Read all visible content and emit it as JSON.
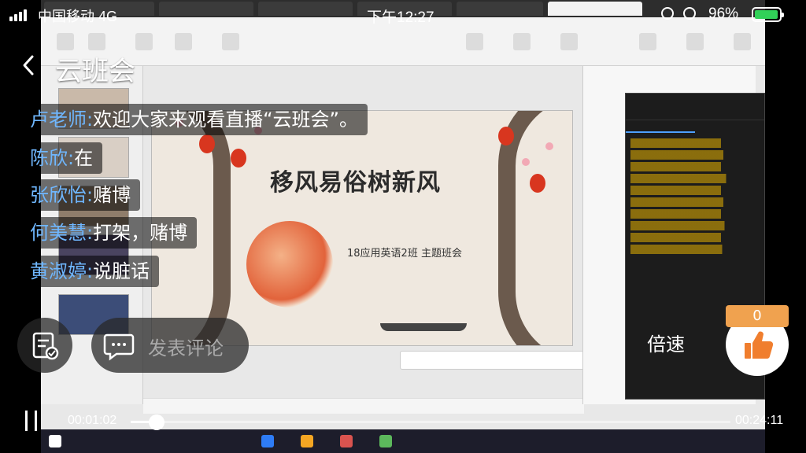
{
  "status_bar": {
    "carrier": "中国移动 4G",
    "time": "下午12:27",
    "battery": "96%",
    "battery_level": 0.96
  },
  "header": {
    "title": "云班会"
  },
  "comments": [
    {
      "name": "卢老师:",
      "text": "欢迎大家来观看直播“云班会”。"
    },
    {
      "name": "陈欣:",
      "text": "在"
    },
    {
      "name": "张欣怡:",
      "text": "赌博"
    },
    {
      "name": "何美慧:",
      "text": "打架，赌博"
    },
    {
      "name": "黄淑婷:",
      "text": "说脏话"
    }
  ],
  "slide": {
    "title": "移风易俗树新风",
    "subtitle": "18应用英语2班 主题班会"
  },
  "controls": {
    "comment_placeholder": "发表评论",
    "speed_label": "倍速",
    "like_count": "0"
  },
  "player": {
    "current_time": "00:01:02",
    "total_time": "00:24:11",
    "progress": 0.043
  },
  "colors": {
    "name_blue": "#6fb7ff",
    "like_badge": "#f0a24f",
    "battery_green": "#31d158",
    "message_yellow": "#e5b000"
  }
}
